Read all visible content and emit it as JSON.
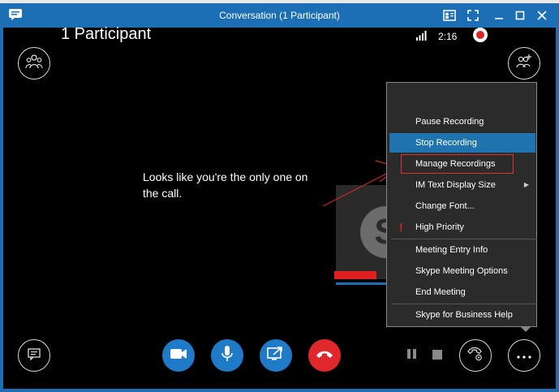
{
  "window": {
    "title": "Conversation (1 Participant)"
  },
  "header": {
    "participants_title": "1 Participant",
    "timer": "2:16"
  },
  "stage": {
    "only_message": "Looks like you're the only one on the call.",
    "avatar_letter": "S"
  },
  "context_menu": {
    "items": [
      {
        "label": "Pause Recording"
      },
      {
        "label": "Stop Recording"
      },
      {
        "label": "Manage Recordings"
      },
      {
        "label": "IM Text Display Size"
      },
      {
        "label": "Change Font..."
      },
      {
        "label": "High Priority"
      },
      {
        "label": "Meeting Entry Info"
      },
      {
        "label": "Skype Meeting Options"
      },
      {
        "label": "End Meeting"
      },
      {
        "label": "Skype for Business Help"
      }
    ]
  },
  "colors": {
    "titlebar": "#1d6fb5",
    "menu_active": "#1f74b0",
    "accent_red": "#e0272c",
    "highlight_box": "#dd3333"
  },
  "icons": {
    "app": "chat-icon",
    "participants": "people-icon",
    "add_people": "add-people-icon",
    "im": "chat-bubble-icon",
    "video": "video-camera-icon",
    "mic": "microphone-icon",
    "share": "present-screen-icon",
    "hangup": "phone-hangup-icon",
    "call_controls": "phone-settings-icon",
    "more": "ellipsis-icon"
  }
}
